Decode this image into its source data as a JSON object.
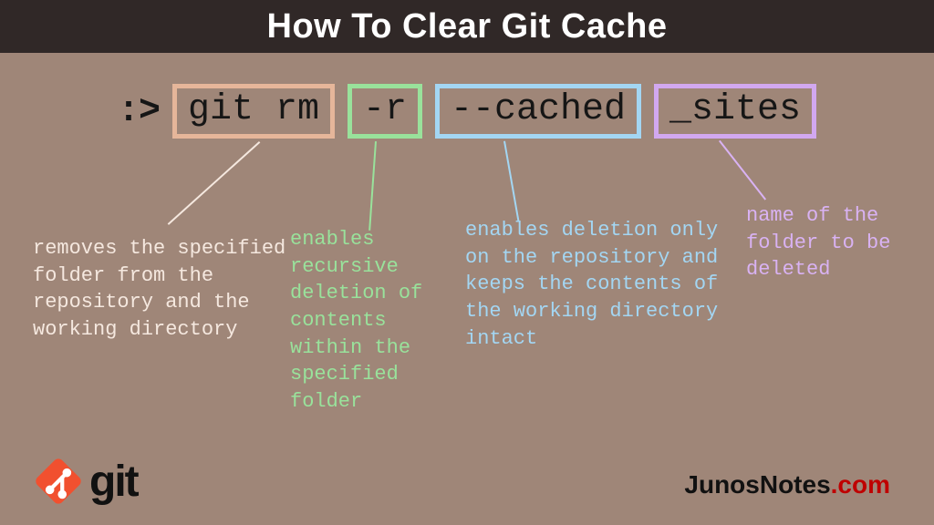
{
  "header": {
    "title": "How To Clear Git Cache"
  },
  "command": {
    "prompt": ":>",
    "tokens": {
      "cmd": "git rm",
      "flag": "-r",
      "opt": "--cached",
      "arg": "_sites"
    }
  },
  "descriptions": {
    "cmd": "removes the specified folder from the repository and the working directory",
    "flag": "enables recursive deletion of contents within the specified folder",
    "opt": "enables deletion only on the repository and keeps the contents of the working directory intact",
    "arg": "name of the folder to be deleted"
  },
  "logo": {
    "text": "git"
  },
  "site": {
    "name": "JunosNotes",
    "tld": ".com"
  }
}
